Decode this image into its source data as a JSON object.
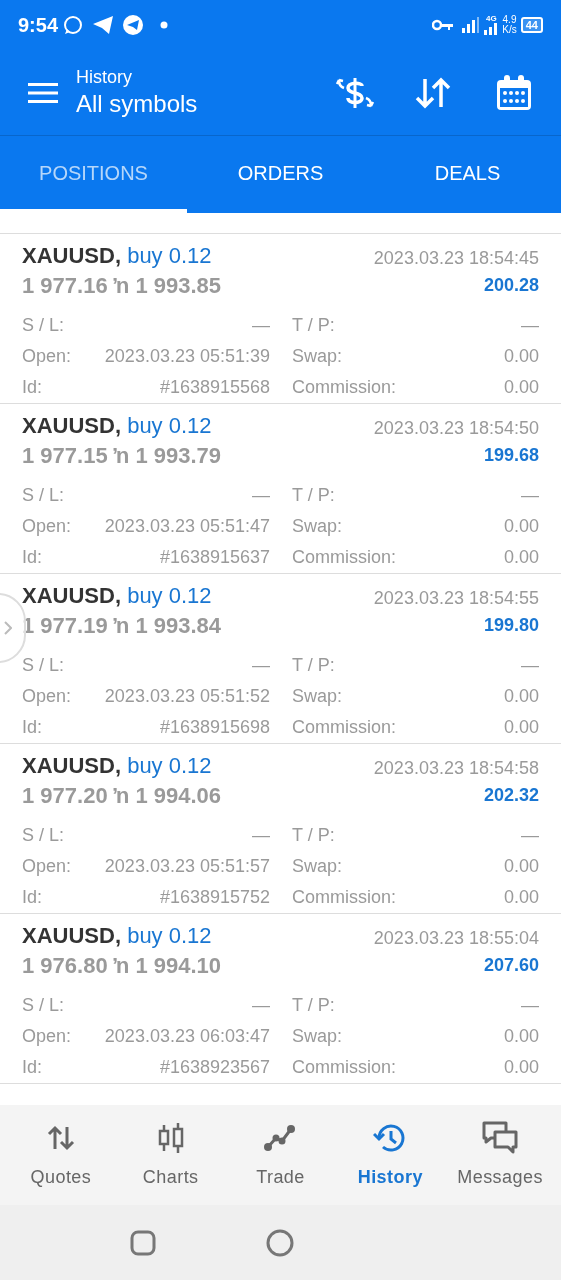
{
  "status_bar": {
    "time": "9:54",
    "speed": "4.9",
    "speed_unit": "K/s",
    "battery": "44",
    "network": "4G"
  },
  "header": {
    "subtitle": "History",
    "title": "All symbols"
  },
  "tabs": [
    {
      "label": "POSITIONS",
      "selected": true
    },
    {
      "label": "ORDERS",
      "selected": false
    },
    {
      "label": "DEALS",
      "selected": false
    }
  ],
  "positions": [
    {
      "symbol": "XAUUSD,",
      "side": "buy 0.12",
      "color": "#1976d2",
      "prices": "1 977.16 ŉ 1 993.85",
      "time": "2023.03.23 18:54:45",
      "profit": "200.28",
      "details": [
        {
          "label": "S / L:",
          "value": "—"
        },
        {
          "label": "T / P:",
          "value": "—"
        },
        {
          "label": "Open:",
          "value": "2023.03.23 05:51:39"
        },
        {
          "label": "Swap:",
          "value": "0.00"
        },
        {
          "label": "Id:",
          "value": "#1638915568"
        },
        {
          "label": "Commission:",
          "value": "0.00"
        }
      ]
    },
    {
      "symbol": "XAUUSD,",
      "side": "buy 0.12",
      "color": "#1976d2",
      "prices": "1 977.15 ŉ 1 993.79",
      "time": "2023.03.23 18:54:50",
      "profit": "199.68",
      "details": [
        {
          "label": "S / L:",
          "value": "—"
        },
        {
          "label": "T / P:",
          "value": "—"
        },
        {
          "label": "Open:",
          "value": "2023.03.23 05:51:47"
        },
        {
          "label": "Swap:",
          "value": "0.00"
        },
        {
          "label": "Id:",
          "value": "#1638915637"
        },
        {
          "label": "Commission:",
          "value": "0.00"
        }
      ]
    },
    {
      "symbol": "XAUUSD,",
      "side": "buy 0.12",
      "color": "#1976d2",
      "prices": "1 977.19 ŉ 1 993.84",
      "time": "2023.03.23 18:54:55",
      "profit": "199.80",
      "details": [
        {
          "label": "S / L:",
          "value": "—"
        },
        {
          "label": "T / P:",
          "value": "—"
        },
        {
          "label": "Open:",
          "value": "2023.03.23 05:51:52"
        },
        {
          "label": "Swap:",
          "value": "0.00"
        },
        {
          "label": "Id:",
          "value": "#1638915698"
        },
        {
          "label": "Commission:",
          "value": "0.00"
        }
      ]
    },
    {
      "symbol": "XAUUSD,",
      "side": "buy 0.12",
      "color": "#1976d2",
      "prices": "1 977.20 ŉ 1 994.06",
      "time": "2023.03.23 18:54:58",
      "profit": "202.32",
      "details": [
        {
          "label": "S / L:",
          "value": "—"
        },
        {
          "label": "T / P:",
          "value": "—"
        },
        {
          "label": "Open:",
          "value": "2023.03.23 05:51:57"
        },
        {
          "label": "Swap:",
          "value": "0.00"
        },
        {
          "label": "Id:",
          "value": "#1638915752"
        },
        {
          "label": "Commission:",
          "value": "0.00"
        }
      ]
    },
    {
      "symbol": "XAUUSD,",
      "side": "buy 0.12",
      "color": "#1976d2",
      "prices": "1 976.80 ŉ 1 994.10",
      "time": "2023.03.23 18:55:04",
      "profit": "207.60",
      "details": [
        {
          "label": "S / L:",
          "value": "—"
        },
        {
          "label": "T / P:",
          "value": "—"
        },
        {
          "label": "Open:",
          "value": "2023.03.23 06:03:47"
        },
        {
          "label": "Swap:",
          "value": "0.00"
        },
        {
          "label": "Id:",
          "value": "#1638923567"
        },
        {
          "label": "Commission:",
          "value": "0.00"
        }
      ]
    }
  ],
  "bottom_nav": [
    {
      "label": "Quotes",
      "selected": false
    },
    {
      "label": "Charts",
      "selected": false
    },
    {
      "label": "Trade",
      "selected": false
    },
    {
      "label": "History",
      "selected": true
    },
    {
      "label": "Messages",
      "selected": false
    }
  ]
}
